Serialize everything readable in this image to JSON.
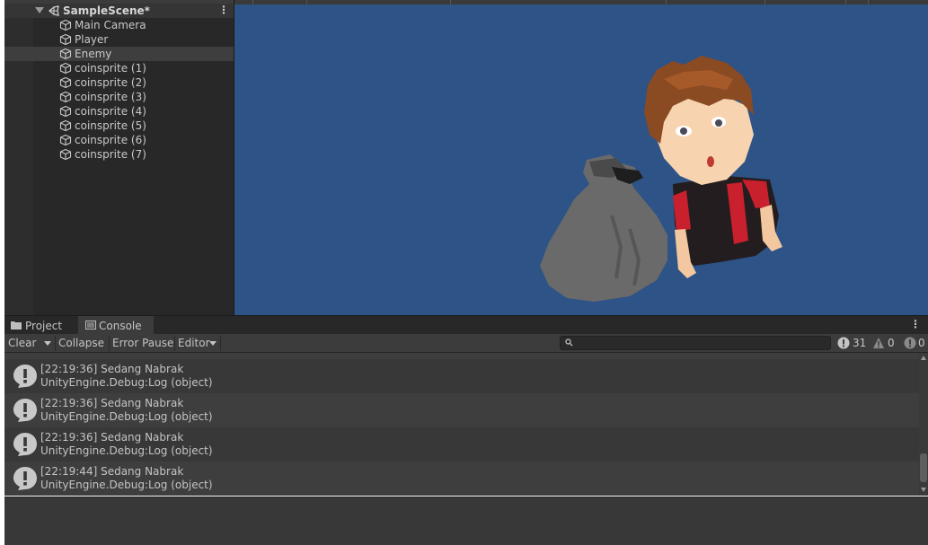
{
  "hierarchy": {
    "scene_name": "SampleScene*",
    "items": [
      {
        "label": "Main Camera"
      },
      {
        "label": "Player"
      },
      {
        "label": "Enemy",
        "selected": true
      },
      {
        "label": "coinsprite (1)"
      },
      {
        "label": "coinsprite (2)"
      },
      {
        "label": "coinsprite (3)"
      },
      {
        "label": "coinsprite (4)"
      },
      {
        "label": "coinsprite (5)"
      },
      {
        "label": "coinsprite (6)"
      },
      {
        "label": "coinsprite (7)"
      }
    ]
  },
  "tabs": {
    "project": "Project",
    "console": "Console",
    "active": "Console"
  },
  "toolbar": {
    "clear": "Clear",
    "collapse": "Collapse",
    "error_pause": "Error Pause",
    "editor": "Editor",
    "search_placeholder": "",
    "log_count": "31",
    "warning_count": "0",
    "error_count": "0"
  },
  "logs": [
    {
      "line1": "[22:19:36] Sedang Nabrak",
      "line2": "UnityEngine.Debug:Log (object)"
    },
    {
      "line1": "[22:19:36] Sedang Nabrak",
      "line2": "UnityEngine.Debug:Log (object)"
    },
    {
      "line1": "[22:19:36] Sedang Nabrak",
      "line2": "UnityEngine.Debug:Log (object)"
    },
    {
      "line1": "[22:19:44] Sedang Nabrak",
      "line2": "UnityEngine.Debug:Log (object)"
    }
  ],
  "colors": {
    "scene_background": "#2e5386",
    "panel_dark": "#282828",
    "toolbar": "#3c3c3c"
  },
  "scene_content": {
    "sprites": [
      "player-character-sprite",
      "trash-bag-enemy-sprite"
    ]
  }
}
